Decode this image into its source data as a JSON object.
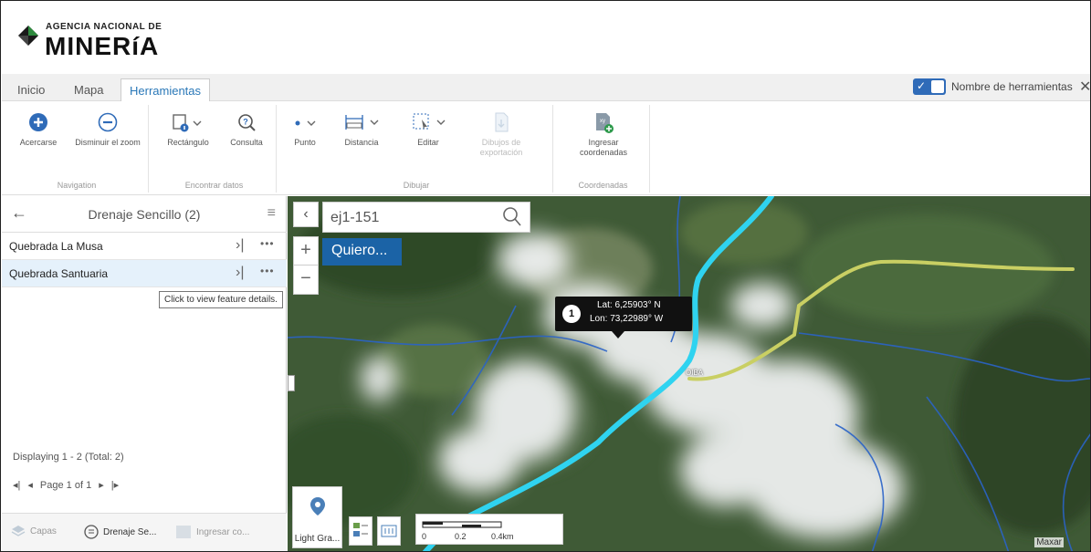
{
  "brand": {
    "line1": "AGENCIA NACIONAL DE",
    "line2": "MINERíA"
  },
  "tabs": [
    {
      "label": "Inicio"
    },
    {
      "label": "Mapa"
    },
    {
      "label": "Herramientas",
      "active": true
    }
  ],
  "toolbar_toggle": {
    "label": "Nombre de herramientas",
    "checked": true
  },
  "ribbon": {
    "groups": [
      {
        "title": "Navigation",
        "buttons": [
          {
            "label": "Acercarse",
            "icon": "zoom-in-icon"
          },
          {
            "label": "Disminuir el zoom",
            "icon": "zoom-out-icon"
          }
        ]
      },
      {
        "title": "Encontrar datos",
        "buttons": [
          {
            "label": "Rectángulo",
            "icon": "rectangle-select-icon"
          },
          {
            "label": "Consulta",
            "icon": "query-icon"
          }
        ]
      },
      {
        "title": "Dibujar",
        "buttons": [
          {
            "label": "Punto",
            "icon": "point-icon"
          },
          {
            "label": "Distancia",
            "icon": "distance-icon"
          },
          {
            "label": "Editar",
            "icon": "edit-icon"
          },
          {
            "label": "Dibujos de exportación",
            "icon": "export-drawing-icon",
            "disabled": true
          }
        ]
      },
      {
        "title": "Coordenadas",
        "buttons": [
          {
            "label": "Ingresar coordenadas",
            "icon": "coordinates-icon"
          }
        ]
      }
    ]
  },
  "panel": {
    "title": "Drenaje Sencillo (2)",
    "items": [
      {
        "name": "Quebrada La Musa"
      },
      {
        "name": "Quebrada Santuaria",
        "selected": true
      }
    ],
    "tooltip": "Click to view feature details.",
    "displaying": "Displaying 1 - 2 (Total: 2)",
    "page_label": "Page 1 of 1",
    "bottom_tabs": [
      {
        "label": "Capas"
      },
      {
        "label": "Drenaje Se...",
        "active": true
      },
      {
        "label": "Ingresar co..."
      }
    ]
  },
  "map": {
    "search_value": "ej1-151",
    "quiero_label": "Quiero...",
    "popup": {
      "number": "1",
      "lat": "Lat: 6,25903° N",
      "lon": "Lon: 73,22989° W"
    },
    "town_label": "OIBA",
    "basemap_label": "Light Gra...",
    "scale": {
      "t0": "0",
      "t1": "0.2",
      "t2": "0.4km"
    },
    "attribution": "Maxar",
    "colors": {
      "river": "#2fd3f0",
      "road": "#c9cf63",
      "stream": "#2a63c8"
    }
  }
}
